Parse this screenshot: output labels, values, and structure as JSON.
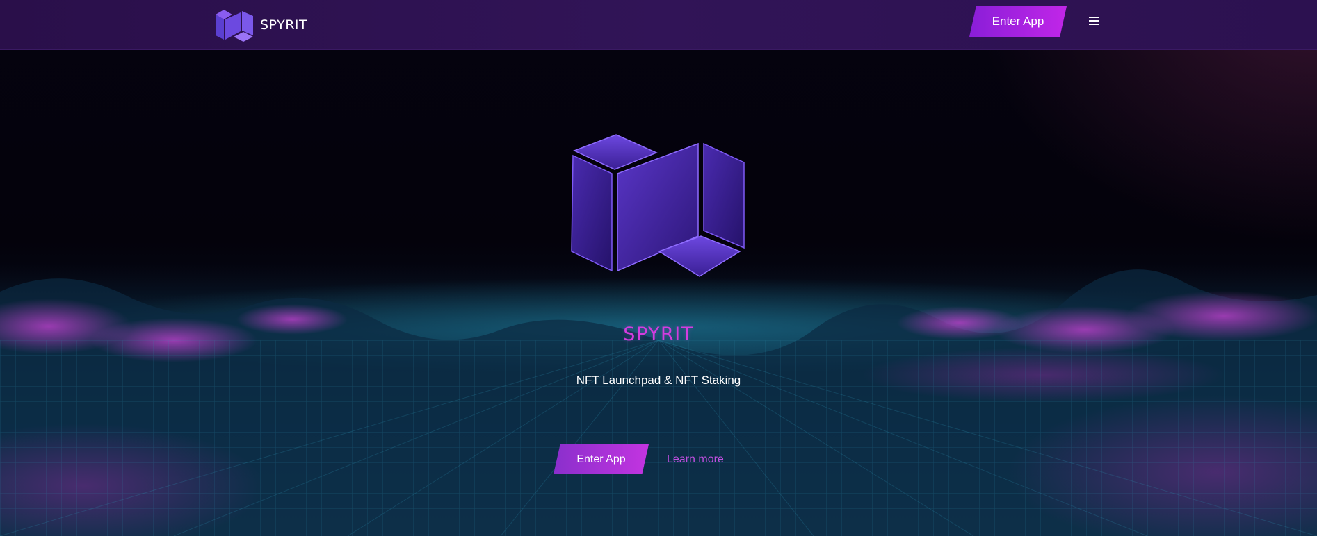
{
  "header": {
    "brand": "SPYRIT",
    "enter_app_label": "Enter App",
    "menu_icon": "hamburger-menu-icon"
  },
  "hero": {
    "logo_icon": "spyrit-cube-logo-icon",
    "title": "SPYRIT",
    "subtitle": "NFT Launchpad & NFT Staking",
    "enter_app_label": "Enter App",
    "learn_more_label": "Learn more"
  },
  "colors": {
    "header_bg": "#311457",
    "accent_purple": "#c126e8",
    "title_magenta": "#d43ce0",
    "link_purple": "#c04fe0",
    "landscape_teal": "#1f7f9e",
    "landscape_pink": "#b23fc4"
  }
}
